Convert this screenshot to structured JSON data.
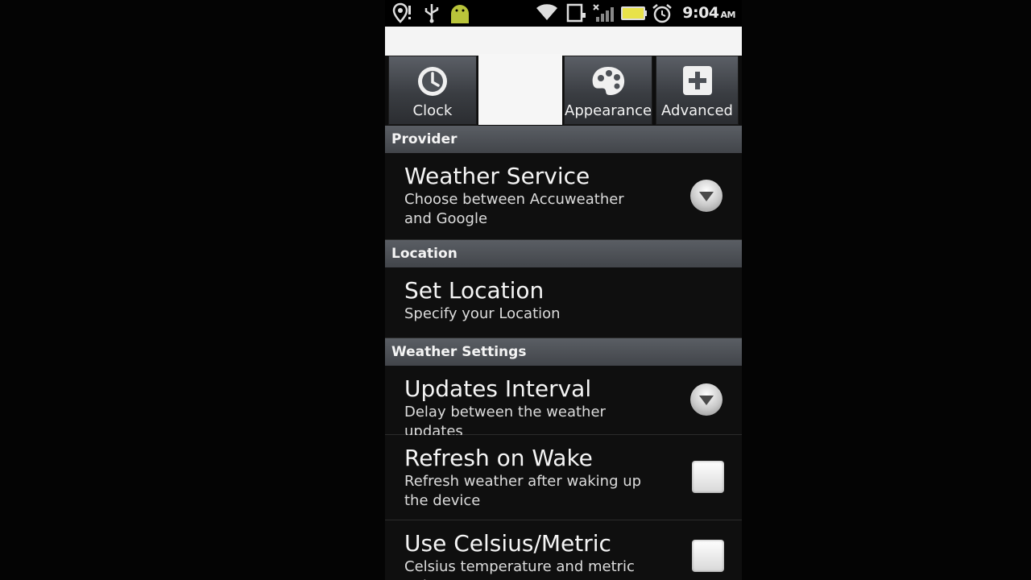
{
  "status_bar": {
    "time": "9:04",
    "ampm": "AM",
    "icons": [
      "location-alert-icon",
      "usb-icon",
      "android-icon",
      "wifi-icon",
      "sd-card-icon",
      "signal-icon",
      "battery-icon",
      "alarm-icon"
    ]
  },
  "tabs": [
    {
      "label": "Clock",
      "icon": "clock-icon",
      "selected": false
    },
    {
      "label": "",
      "icon": "",
      "selected": true
    },
    {
      "label": "Appearance",
      "icon": "palette-icon",
      "selected": false
    },
    {
      "label": "Advanced",
      "icon": "plus-icon",
      "selected": false
    }
  ],
  "sections": {
    "provider": {
      "header": "Provider",
      "weather_service": {
        "title": "Weather Service",
        "summary": "Choose between Accuweather and Google"
      }
    },
    "location": {
      "header": "Location",
      "set_location": {
        "title": "Set Location",
        "summary": "Specify your Location"
      }
    },
    "weather_settings": {
      "header": "Weather Settings",
      "updates_interval": {
        "title": "Updates Interval",
        "summary": "Delay between the weather updates"
      },
      "refresh_on_wake": {
        "title": "Refresh on Wake",
        "summary": "Refresh weather after waking up the device",
        "checked": false
      },
      "use_celsius": {
        "title": "Use Celsius/Metric",
        "summary": "Celsius temperature and metric units",
        "checked": false
      }
    }
  }
}
